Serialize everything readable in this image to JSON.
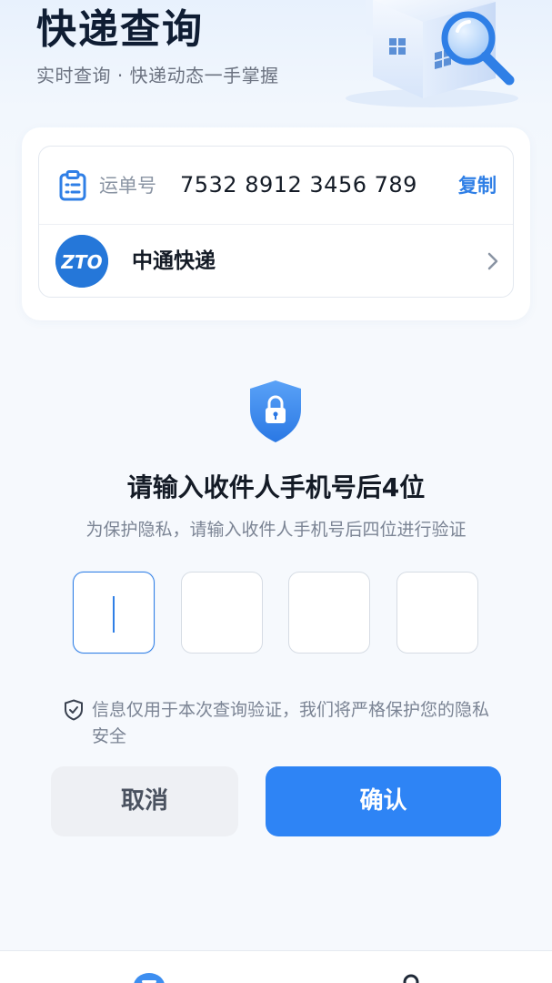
{
  "header": {
    "title": "快递查询",
    "subtitle": "实时查询 · 快递动态一手掌握"
  },
  "waybill": {
    "label": "运单号",
    "number": "7532 8912 3456 789",
    "copy_label": "复制",
    "courier_logo_text": "ZTO",
    "courier_name": "中通快递"
  },
  "verify": {
    "title": "请输入收件人手机号后4位",
    "description": "为保护隐私，请输入收件人手机号后四位进行验证",
    "digits": [
      "",
      "",
      "",
      ""
    ],
    "active_index": 0,
    "privacy_note": "信息仅用于本次查询验证，我们将严格保护您的隐私安全"
  },
  "actions": {
    "cancel_label": "取消",
    "confirm_label": "确认"
  },
  "tabbar": {
    "items": [
      {
        "icon": "home-icon",
        "active": true
      },
      {
        "icon": "user-icon",
        "active": false
      }
    ]
  },
  "colors": {
    "accent": "#2e84f5",
    "title": "#0f1d33",
    "muted": "#7b8494",
    "courier_brand": "#2577d9"
  }
}
